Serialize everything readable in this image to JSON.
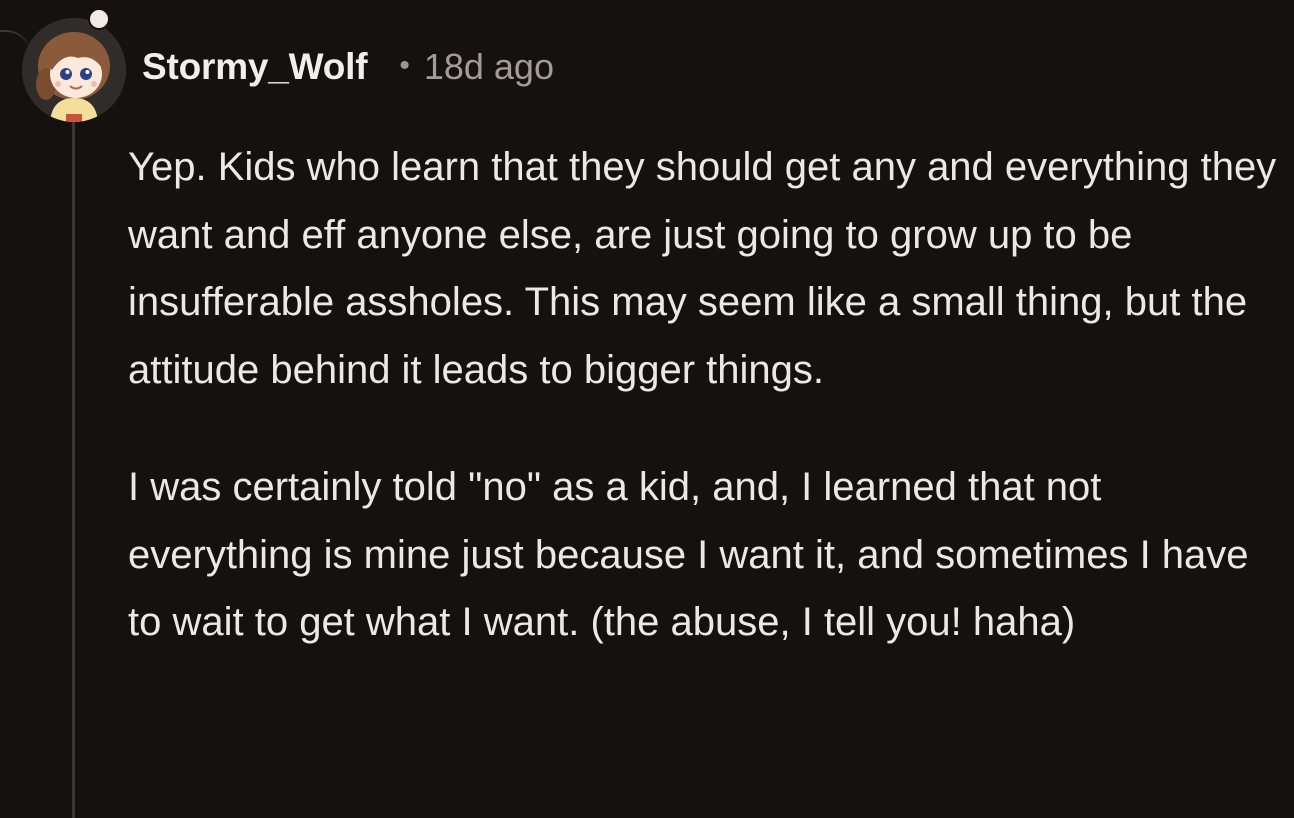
{
  "comment": {
    "author": "Stormy_Wolf",
    "separator": "•",
    "time": "18d ago",
    "paragraphs": [
      "Yep. Kids who learn that they should get any and everything they want and eff anyone else, are just going to grow up to be insufferable assholes. This may seem like a small thing, but the attitude behind it leads to bigger things.",
      "I was certainly told \"no\" as a kid, and, I learned that not everything is mine just because I want it, and sometimes I have to wait to get what I want. (the abuse, I tell you! haha)"
    ]
  },
  "avatar": {
    "icon": "cartoon-girl-avatar-icon",
    "background": "#2f2c2a",
    "hair_color": "#8a5a3b",
    "shirt_color": "#f3df9a"
  },
  "colors": {
    "background": "#14110f",
    "text": "#ece8e3",
    "muted": "#a29c96",
    "thread_line": "#3a3633"
  }
}
